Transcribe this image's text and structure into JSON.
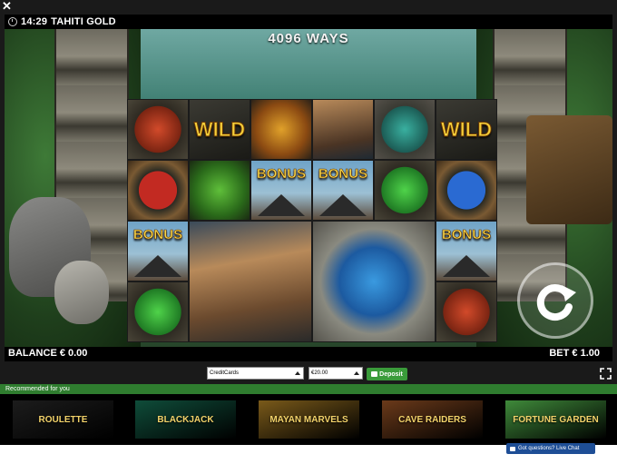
{
  "window": {
    "close_glyph": "✕"
  },
  "titlebar": {
    "time": "14:29",
    "title": "TAHITI GOLD"
  },
  "game": {
    "ways_text": "4096 WAYS",
    "reels": [
      {
        "symbol": "frog-red",
        "label": ""
      },
      {
        "symbol": "wild",
        "label": "WILD"
      },
      {
        "symbol": "tiki-mask-gold",
        "label": ""
      },
      {
        "symbol": "warrior-portrait",
        "label": ""
      },
      {
        "symbol": "turtle-teal",
        "label": ""
      },
      {
        "symbol": "wild",
        "label": "WILD"
      },
      {
        "symbol": "red-disc",
        "label": ""
      },
      {
        "symbol": "tiki-mask-green",
        "label": ""
      },
      {
        "symbol": "bonus",
        "label": "BONUS"
      },
      {
        "symbol": "bonus",
        "label": "BONUS"
      },
      {
        "symbol": "lizard-green",
        "label": ""
      },
      {
        "symbol": "blue-disc",
        "label": ""
      },
      {
        "symbol": "bonus",
        "label": "BONUS"
      },
      {
        "symbol": "warrior-large",
        "label": ""
      },
      {
        "symbol": "shark-blue-large",
        "label": ""
      },
      {
        "symbol": "bonus",
        "label": "BONUS"
      },
      {
        "symbol": "lizard-green",
        "label": ""
      },
      {
        "symbol": "frog-red",
        "label": ""
      }
    ],
    "spin_icon": "spin-arrow-icon"
  },
  "infobar": {
    "balance": "BALANCE € 0.00",
    "bet": "BET € 1.00"
  },
  "controls": {
    "payment_select": "CreditCards",
    "amount_select": "€20.00",
    "deposit_label": "Deposit"
  },
  "recommended": {
    "heading": "Recommended for you",
    "games": [
      {
        "name": "ROULETTE",
        "color": "#1c1c1c"
      },
      {
        "name": "BLACKJACK",
        "color": "#0f4d3a"
      },
      {
        "name": "MAYAN MARVELS",
        "color": "#7a5a1a"
      },
      {
        "name": "CAVE RAIDERS",
        "color": "#6b3a1a"
      },
      {
        "name": "FORTUNE GARDEN",
        "color": "#3f8a3a"
      }
    ]
  },
  "chat": {
    "label": "Got questions? Live Chat"
  }
}
